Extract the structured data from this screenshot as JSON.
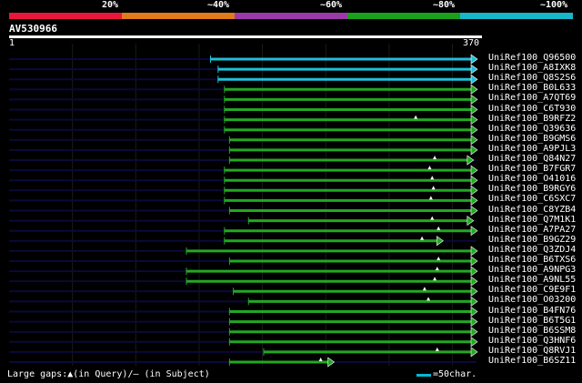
{
  "legend": {
    "labels": [
      "20%",
      "~40%",
      "~60%",
      "~80%",
      "~100%"
    ],
    "colors": [
      "#e8173a",
      "#e07a1a",
      "#9a3aa8",
      "#1aa01a",
      "#17b7c9"
    ]
  },
  "query": {
    "id": "AV530966",
    "start": "1",
    "end": "370"
  },
  "query_length": 370,
  "colors": {
    "hit_cyan": "#1ec0d8",
    "hit_green": "#22a822",
    "track": "#0a0a3a",
    "grid": "#1a1a1a"
  },
  "hits": [
    {
      "name": "UniRef100_Q96500",
      "start": 160,
      "end": 370,
      "color": "cyan",
      "arrow": "right"
    },
    {
      "name": "UniRef100_A8IXK8",
      "start": 166,
      "end": 370,
      "color": "cyan",
      "arrow": "right"
    },
    {
      "name": "UniRef100_Q8S2S6",
      "start": 166,
      "end": 370,
      "color": "cyan",
      "arrow": "right"
    },
    {
      "name": "UniRef100_B0L633",
      "start": 171,
      "end": 370,
      "color": "green",
      "arrow": "right"
    },
    {
      "name": "UniRef100_A7QT69",
      "start": 171,
      "end": 370,
      "color": "green",
      "arrow": "right"
    },
    {
      "name": "UniRef100_C6T930",
      "start": 171,
      "end": 370,
      "color": "green",
      "arrow": "right"
    },
    {
      "name": "UniRef100_B9RFZ2",
      "start": 171,
      "end": 370,
      "color": "green",
      "arrow": "right",
      "gap": 322
    },
    {
      "name": "UniRef100_Q39636",
      "start": 171,
      "end": 370,
      "color": "green",
      "arrow": "right"
    },
    {
      "name": "UniRef100_B9GMS6",
      "start": 175,
      "end": 370,
      "color": "green",
      "arrow": "right"
    },
    {
      "name": "UniRef100_A9PJL3",
      "start": 175,
      "end": 370,
      "color": "green",
      "arrow": "right"
    },
    {
      "name": "UniRef100_Q84N27",
      "start": 175,
      "end": 367,
      "color": "green",
      "arrow": "right",
      "gap": 337
    },
    {
      "name": "UniRef100_B7FGR7",
      "start": 171,
      "end": 370,
      "color": "green",
      "arrow": "right",
      "gap": 333
    },
    {
      "name": "UniRef100_O41016",
      "start": 171,
      "end": 370,
      "color": "green",
      "arrow": "right",
      "gap": 335
    },
    {
      "name": "UniRef100_B9RGY6",
      "start": 171,
      "end": 370,
      "color": "green",
      "arrow": "right",
      "gap": 336
    },
    {
      "name": "UniRef100_C6SXC7",
      "start": 171,
      "end": 370,
      "color": "green",
      "arrow": "right",
      "gap": 334
    },
    {
      "name": "UniRef100_C8YZB4",
      "start": 175,
      "end": 370,
      "color": "green",
      "arrow": "right"
    },
    {
      "name": "UniRef100_Q7M1K1",
      "start": 190,
      "end": 367,
      "color": "green",
      "arrow": "right",
      "gap": 335
    },
    {
      "name": "UniRef100_A7PA27",
      "start": 171,
      "end": 370,
      "color": "green",
      "arrow": "right",
      "gap": 340
    },
    {
      "name": "UniRef100_B9GZ29",
      "start": 171,
      "end": 343,
      "color": "green",
      "arrow": "right",
      "gap": 327
    },
    {
      "name": "UniRef100_Q3ZDJ4",
      "start": 141,
      "end": 370,
      "color": "green",
      "arrow": "right"
    },
    {
      "name": "UniRef100_B6TXS6",
      "start": 175,
      "end": 370,
      "color": "green",
      "arrow": "right",
      "gap": 340
    },
    {
      "name": "UniRef100_A9NPG3",
      "start": 141,
      "end": 370,
      "color": "green",
      "arrow": "right",
      "gap": 339
    },
    {
      "name": "UniRef100_A9NL55",
      "start": 141,
      "end": 370,
      "color": "green",
      "arrow": "right",
      "gap": 337
    },
    {
      "name": "UniRef100_C9E9F1",
      "start": 178,
      "end": 370,
      "color": "green",
      "arrow": "right",
      "gap": 329
    },
    {
      "name": "UniRef100_O03200",
      "start": 190,
      "end": 370,
      "color": "green",
      "arrow": "right",
      "gap": 332
    },
    {
      "name": "UniRef100_B4FN76",
      "start": 175,
      "end": 370,
      "color": "green",
      "arrow": "right"
    },
    {
      "name": "UniRef100_B6T5G1",
      "start": 175,
      "end": 370,
      "color": "green",
      "arrow": "right"
    },
    {
      "name": "UniRef100_B6SSM8",
      "start": 175,
      "end": 370,
      "color": "green",
      "arrow": "right"
    },
    {
      "name": "UniRef100_Q3HNF6",
      "start": 175,
      "end": 370,
      "color": "green",
      "arrow": "right"
    },
    {
      "name": "UniRef100_Q8RVJ1",
      "start": 202,
      "end": 370,
      "color": "green",
      "arrow": "right",
      "gap": 339
    },
    {
      "name": "UniRef100_B6SZ11",
      "start": 175,
      "end": 257,
      "color": "green",
      "arrow": "right",
      "gap": 247
    }
  ],
  "footer": {
    "gaps_text": "Large gaps:▲(in Query)/– (in Subject)",
    "scale_text": "=50char."
  }
}
